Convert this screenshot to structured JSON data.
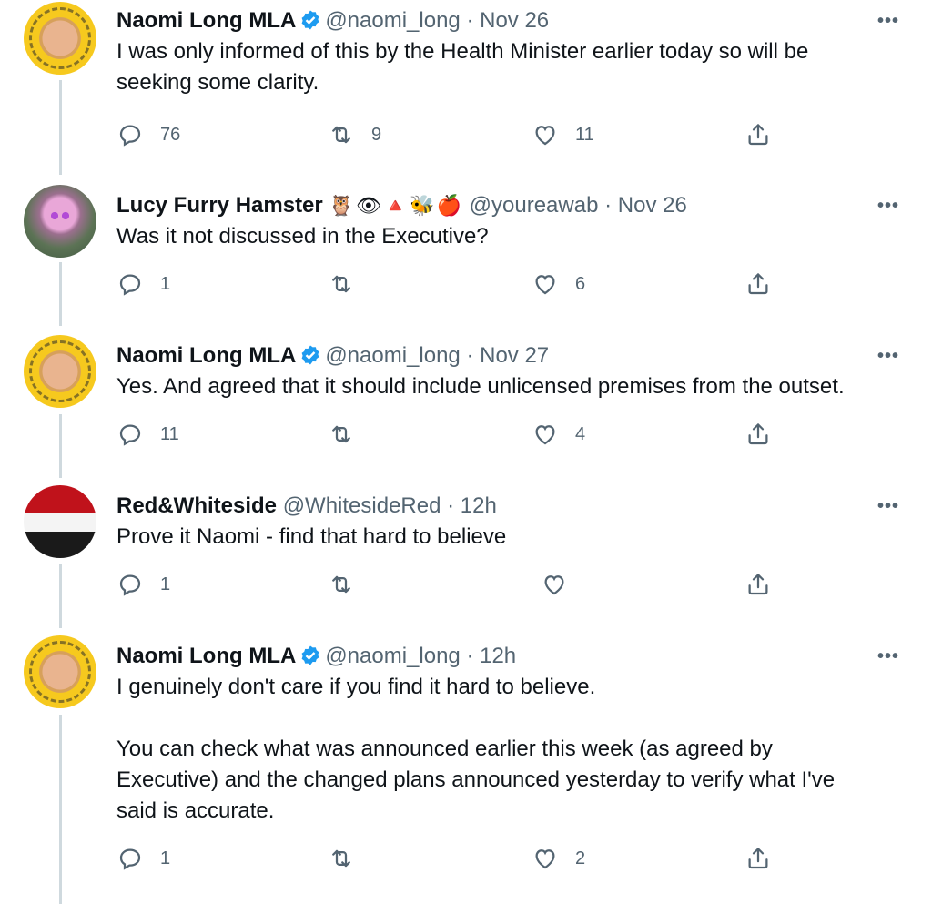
{
  "tweets": [
    {
      "author": "Naomi Long MLA",
      "verified": true,
      "handle": "@naomi_long",
      "time": "Nov 26",
      "text": "I was only informed of this by the Health Minister earlier today so will be\nseeking some clarity.",
      "replies": "76",
      "retweets": "9",
      "likes": "11"
    },
    {
      "author": "Lucy Furry Hamster",
      "emojis": [
        "🦉",
        "👁",
        "🔺",
        "🐝",
        "🍎"
      ],
      "verified": false,
      "handle": "@youreawab",
      "time": "Nov 26",
      "text": "Was it not discussed in the Executive?",
      "replies": "1",
      "retweets": "",
      "likes": "6"
    },
    {
      "author": "Naomi Long MLA",
      "verified": true,
      "handle": "@naomi_long",
      "time": "Nov 27",
      "text": "Yes. And agreed that it should include unlicensed premises from the outset.",
      "replies": "11",
      "retweets": "",
      "likes": "4"
    },
    {
      "author": "Red&Whiteside",
      "verified": false,
      "handle": "@WhitesideRed",
      "time": "12h",
      "text": "Prove it Naomi - find that hard to believe",
      "replies": "1",
      "retweets": "",
      "likes": ""
    },
    {
      "author": "Naomi Long MLA",
      "verified": true,
      "handle": "@naomi_long",
      "time": "12h",
      "text": "I genuinely don't care if you find it hard to believe.\n\nYou can check what was announced earlier this week (as agreed by\nExecutive) and the changed plans announced yesterday to verify what I've\nsaid is accurate.",
      "replies": "1",
      "retweets": "",
      "likes": "2"
    }
  ],
  "separator": "·",
  "more_glyph": "•••",
  "colors": {
    "verified": "#1d9bf0",
    "muted": "#536471",
    "thread_line": "#cfd9de"
  }
}
